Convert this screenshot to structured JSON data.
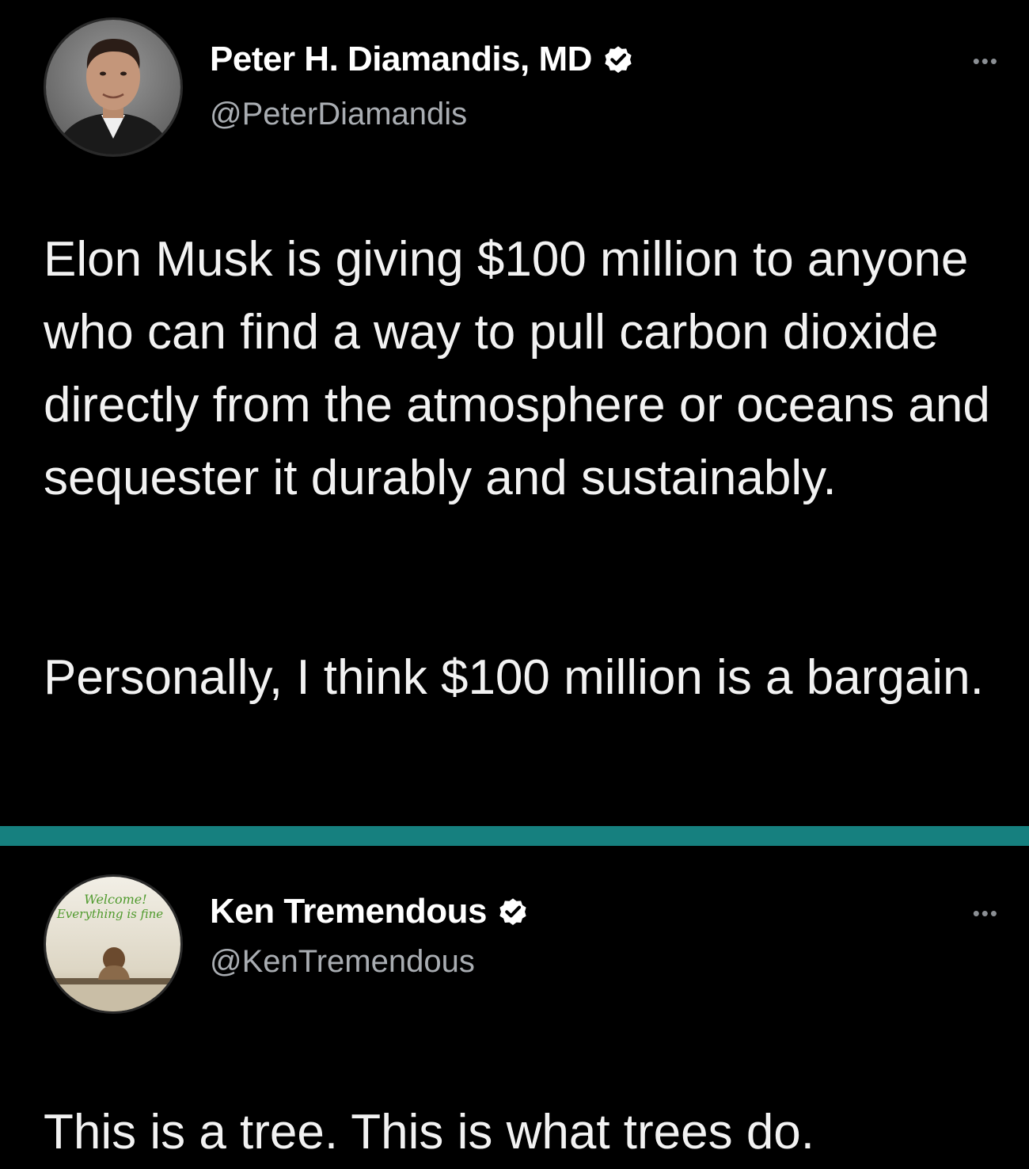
{
  "tweets": [
    {
      "display_name": "Peter H. Diamandis, MD",
      "handle": "@PeterDiamandis",
      "verified": true,
      "more_icon": "more-icon",
      "paragraphs": [
        "Elon Musk is giving $100 million to anyone who can find a way to pull carbon dioxide directly from the atmosphere or oceans and sequester it durably and sustainably.",
        "Personally, I think $100 million is a bargain."
      ]
    },
    {
      "display_name": "Ken Tremendous",
      "handle": "@KenTremendous",
      "verified": true,
      "avatar_text": {
        "line1": "Welcome!",
        "line2": "Everything is fine"
      },
      "more_icon": "more-icon",
      "paragraphs": [
        "This is a tree. This is what trees do."
      ]
    }
  ],
  "colors": {
    "background": "#000000",
    "separator": "#16807f",
    "verified_badge": "#ffffff"
  }
}
